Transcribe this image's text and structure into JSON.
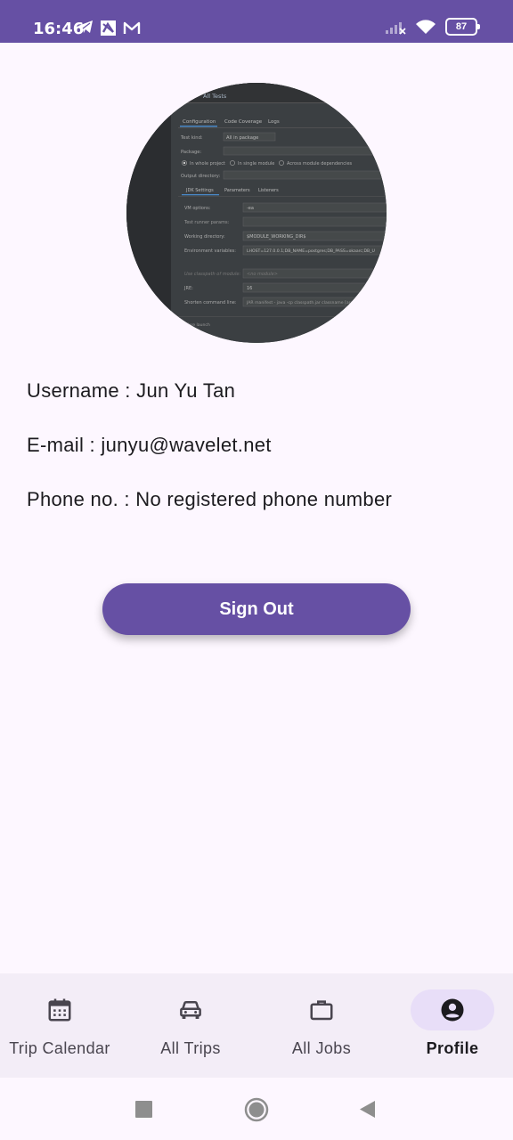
{
  "status_bar": {
    "time": "16:46",
    "notification_icons": [
      "telegram-icon",
      "app-icon",
      "gmail-icon"
    ],
    "battery": "87"
  },
  "profile": {
    "username_label": "Username :",
    "username": "Jun Yu Tan",
    "email_label": "E-mail :",
    "email": "junyu@wavelet.net",
    "phone_label": "Phone no. :",
    "phone": "No registered phone number"
  },
  "avatar_screenshot": {
    "title": "All Tests",
    "tabs": [
      "Configuration",
      "Code Coverage",
      "Logs"
    ],
    "rows": [
      {
        "label": "Test kind:",
        "value": "All in package"
      },
      {
        "label": "Package:",
        "value": ""
      },
      {
        "label": "Output directory:",
        "value": ""
      }
    ],
    "scope_options": [
      "In whole project",
      "In single module",
      "Across module dependencies"
    ],
    "subtabs": [
      "JDK Settings",
      "Parameters",
      "Listeners"
    ],
    "settings": [
      {
        "label": "VM options:",
        "value": "-ea"
      },
      {
        "label": "Test runner params:",
        "value": ""
      },
      {
        "label": "Working directory:",
        "value": "$MODULE_WORKING_DIR$"
      },
      {
        "label": "Environment variables:",
        "value": "LHOST=127.0.0.1;DB_NAME=postgres;DB_PASS=okaarc;DB_U"
      },
      {
        "label": "Use classpath of module:",
        "value": "<no module>"
      },
      {
        "label": "JRE:",
        "value": "16"
      },
      {
        "label": "Shorten command line:",
        "value": "JAR manifest - java -cp classpath.jar classname [args]"
      }
    ],
    "footer": "Before launch"
  },
  "actions": {
    "sign_out": "Sign Out"
  },
  "bottom_nav": [
    {
      "label": "Trip Calendar",
      "icon": "calendar-icon",
      "active": false
    },
    {
      "label": "All Trips",
      "icon": "car-icon",
      "active": false
    },
    {
      "label": "All Jobs",
      "icon": "briefcase-icon",
      "active": false
    },
    {
      "label": "Profile",
      "icon": "account-circle-icon",
      "active": true
    }
  ],
  "colors": {
    "primary": "#6650a4",
    "background": "#fdf7ff",
    "nav_background": "#f3edf7",
    "nav_indicator": "#e8def8"
  }
}
